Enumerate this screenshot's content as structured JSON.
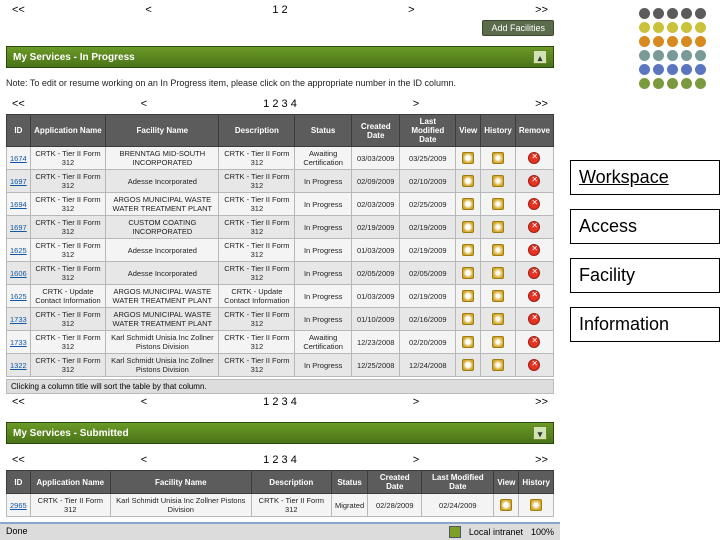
{
  "pager": {
    "first": "<<",
    "prev": "<",
    "mid12": "1 2",
    "mid1234": "1 2 3 4",
    "next": ">",
    "last": ">>"
  },
  "buttons": {
    "add_facilities": "Add Facilities"
  },
  "sections": {
    "in_progress_title": "My Services - In Progress",
    "submitted_title": "My Services - Submitted",
    "toggle_collapse": "▴",
    "toggle_expand": "▾"
  },
  "note": "Note: To edit or resume working on an In Progress item, please click on the appropriate number in the ID column.",
  "headers": {
    "id": "ID",
    "app": "Application Name",
    "fac": "Facility Name",
    "desc": "Description",
    "status": "Status",
    "created": "Created Date",
    "modified": "Last Modified Date",
    "view": "View",
    "history": "History",
    "remove": "Remove"
  },
  "rows_in_progress": [
    {
      "id": "1674",
      "app": "CRTK - Tier II Form 312",
      "fac": "BRENNTAG MID-SOUTH INCORPORATED",
      "desc": "CRTK - Tier II Form 312",
      "status": "Awaiting Certification",
      "created": "03/03/2009",
      "modified": "03/25/2009"
    },
    {
      "id": "1697",
      "app": "CRTK - Tier II Form 312",
      "fac": "Adesse Incorporated",
      "desc": "CRTK - Tier II Form 312",
      "status": "In Progress",
      "created": "02/09/2009",
      "modified": "02/10/2009"
    },
    {
      "id": "1694",
      "app": "CRTK - Tier II Form 312",
      "fac": "ARGOS MUNICIPAL WASTE WATER TREATMENT PLANT",
      "desc": "CRTK - Tier II Form 312",
      "status": "In Progress",
      "created": "02/03/2009",
      "modified": "02/25/2009"
    },
    {
      "id": "1697",
      "app": "CRTK - Tier II Form 312",
      "fac": "CUSTOM COATING INCORPORATED",
      "desc": "CRTK - Tier II Form 312",
      "status": "In Progress",
      "created": "02/19/2009",
      "modified": "02/19/2009"
    },
    {
      "id": "1625",
      "app": "CRTK - Tier II Form 312",
      "fac": "Adesse Incorporated",
      "desc": "CRTK - Tier II Form 312",
      "status": "In Progress",
      "created": "01/03/2009",
      "modified": "02/19/2009"
    },
    {
      "id": "1606",
      "app": "CRTK - Tier II Form 312",
      "fac": "Adesse Incorporated",
      "desc": "CRTK - Tier II Form 312",
      "status": "In Progress",
      "created": "02/05/2009",
      "modified": "02/05/2009"
    },
    {
      "id": "1625",
      "app": "CRTK - Update Contact Information",
      "fac": "ARGOS MUNICIPAL WASTE WATER TREATMENT PLANT",
      "desc": "CRTK - Update Contact Information",
      "status": "In Progress",
      "created": "01/03/2009",
      "modified": "02/19/2009"
    },
    {
      "id": "1733",
      "app": "CRTK - Tier II Form 312",
      "fac": "ARGOS MUNICIPAL WASTE WATER TREATMENT PLANT",
      "desc": "CRTK - Tier II Form 312",
      "status": "In Progress",
      "created": "01/10/2009",
      "modified": "02/16/2009"
    },
    {
      "id": "1733",
      "app": "CRTK - Tier II Form 312",
      "fac": "Karl Schmidt Unisia Inc Zollner Pistons Division",
      "desc": "CRTK - Tier II Form 312",
      "status": "Awaiting Certification",
      "created": "12/23/2008",
      "modified": "02/20/2009"
    },
    {
      "id": "1322",
      "app": "CRTK - Tier II Form 312",
      "fac": "Karl Schmidt Unisia Inc Zollner Pistons Division",
      "desc": "CRTK - Tier II Form 312",
      "status": "In Progress",
      "created": "12/25/2008",
      "modified": "12/24/2008"
    }
  ],
  "sort_note": "Clicking a column title will sort the table by that column.",
  "rows_submitted": [
    {
      "id": "2965",
      "app": "CRTK - Tier II Form 312",
      "fac": "Karl Schmidt Unisia Inc Zollner Pistons Division",
      "desc": "CRTK - Tier II Form 312",
      "status": "Migrated",
      "created": "02/28/2009",
      "modified": "02/24/2009"
    }
  ],
  "statusbar": {
    "left": "Done",
    "intranet": "Local intranet",
    "zoom": "100%"
  },
  "dot_colors": [
    [
      "#5b5b5b",
      "#5b5b5b",
      "#5b5b5b",
      "#5b5b5b",
      "#5b5b5b"
    ],
    [
      "#c9c23a",
      "#c9c23a",
      "#c9c23a",
      "#c9c23a",
      "#c9c23a"
    ],
    [
      "#d68a1f",
      "#d68a1f",
      "#d68a1f",
      "#d68a1f",
      "#d68a1f"
    ],
    [
      "#7a9a9a",
      "#7a9a9a",
      "#7a9a9a",
      "#7a9a9a",
      "#7a9a9a"
    ],
    [
      "#5a76c0",
      "#5a76c0",
      "#5a76c0",
      "#5a76c0",
      "#5a76c0"
    ],
    [
      "#7b9a3e",
      "#7b9a3e",
      "#7b9a3e",
      "#7b9a3e",
      "#7b9a3e"
    ]
  ],
  "right_labels": {
    "workspace": "Workspace",
    "access": "Access",
    "facility": "Facility",
    "information": "Information"
  }
}
